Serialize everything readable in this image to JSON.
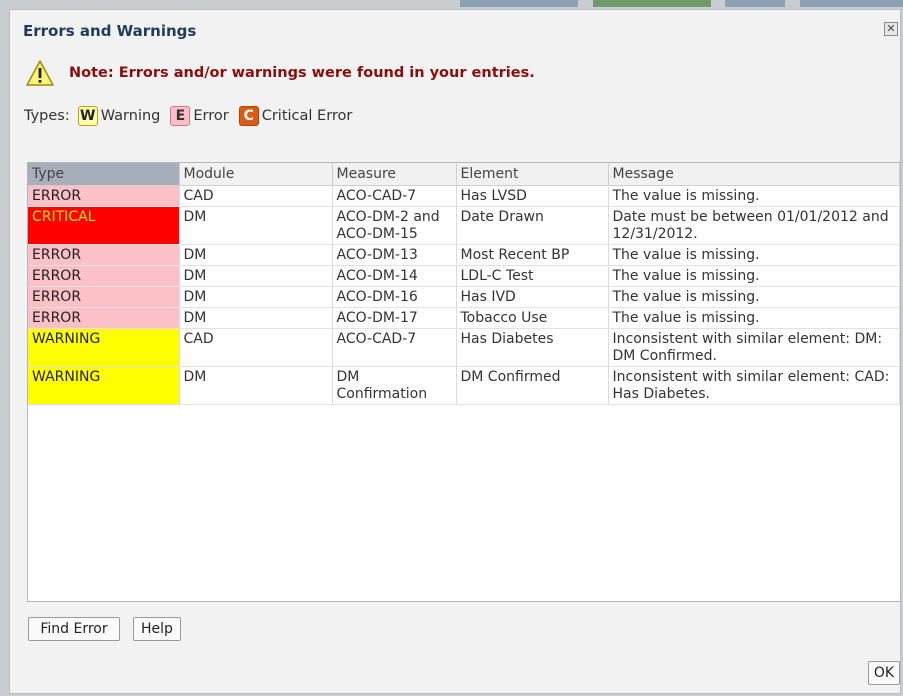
{
  "dialog": {
    "title": "Errors and Warnings",
    "close_icon": "close-icon",
    "note": "Note: Errors and/or warnings were found in your entries.",
    "note_icon": "warning-triangle-icon",
    "types_label": "Types:",
    "types": [
      {
        "badge": "W",
        "name": "Warning",
        "color": "#fdfcb1"
      },
      {
        "badge": "E",
        "name": "Error",
        "color": "#fbc1c7"
      },
      {
        "badge": "C",
        "name": "Critical Error",
        "color": "#d95b14"
      }
    ]
  },
  "table": {
    "columns": [
      "Type",
      "Module",
      "Measure",
      "Element",
      "Message"
    ],
    "rows": [
      {
        "type": "ERROR",
        "module": "CAD",
        "measure": "ACO-CAD-7",
        "element": "Has LVSD",
        "message": "The value is missing."
      },
      {
        "type": "CRITICAL",
        "module": "DM",
        "measure": "ACO-DM-2 and ACO-DM-15",
        "element": "Date Drawn",
        "message": "Date must be between 01/01/2012 and 12/31/2012."
      },
      {
        "type": "ERROR",
        "module": "DM",
        "measure": "ACO-DM-13",
        "element": "Most Recent BP",
        "message": "The value is missing."
      },
      {
        "type": "ERROR",
        "module": "DM",
        "measure": "ACO-DM-14",
        "element": "LDL-C Test",
        "message": "The value is missing."
      },
      {
        "type": "ERROR",
        "module": "DM",
        "measure": "ACO-DM-16",
        "element": "Has IVD",
        "message": "The value is missing."
      },
      {
        "type": "ERROR",
        "module": "DM",
        "measure": "ACO-DM-17",
        "element": "Tobacco Use",
        "message": "The value is missing."
      },
      {
        "type": "WARNING",
        "module": "CAD",
        "measure": "ACO-CAD-7",
        "element": "Has Diabetes",
        "message": "Inconsistent with similar element: DM: DM Confirmed."
      },
      {
        "type": "WARNING",
        "module": "DM",
        "measure": "DM Confirmation",
        "element": "DM Confirmed",
        "message": "Inconsistent with similar element: CAD: Has Diabetes."
      }
    ]
  },
  "buttons": {
    "find_error": "Find Error",
    "help": "Help",
    "ok": "OK"
  },
  "colors": {
    "error": "#fbc1c7",
    "critical": "#ff0000",
    "critical_text": "#ffe600",
    "warning": "#ffff00",
    "note_text": "#8b0e0e",
    "title_text": "#1f3c5c"
  }
}
